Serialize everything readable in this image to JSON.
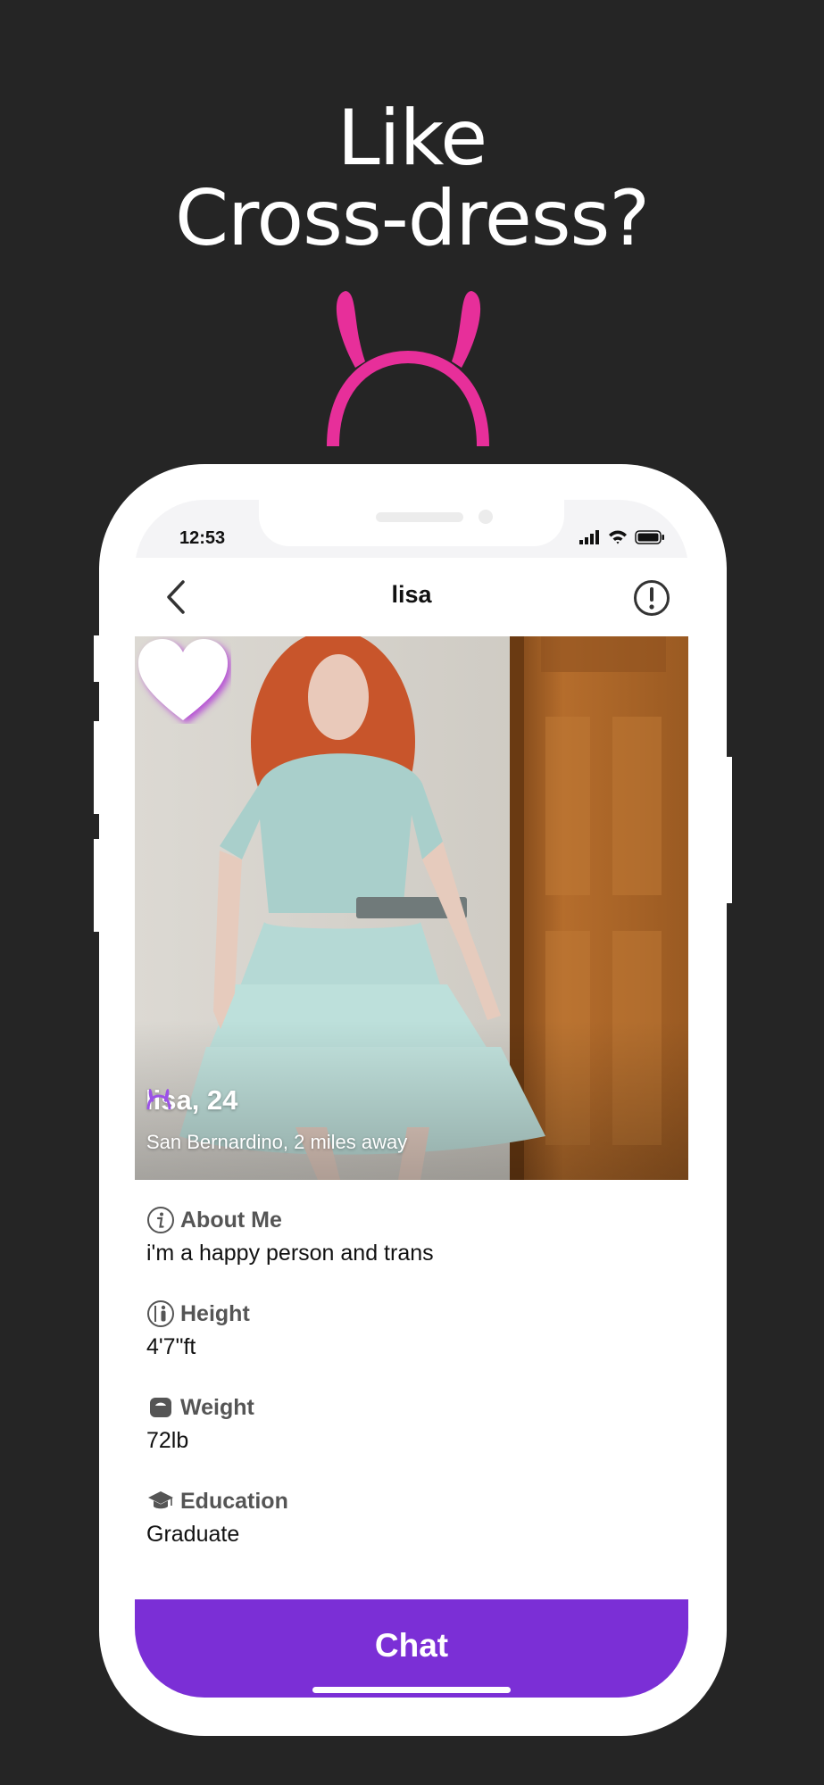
{
  "headline": {
    "line1": "Like",
    "line2": "Cross-dress?"
  },
  "colors": {
    "background": "#252525",
    "accent_pink": "#e72f9a",
    "chat_purple": "#7b2fd6",
    "icon_purple": "#9b52e6"
  },
  "status_bar": {
    "time": "12:53"
  },
  "nav": {
    "title": "lisa",
    "back_icon": "chevron-left-icon",
    "report_icon": "exclamation-circle-icon"
  },
  "profile": {
    "name_age": "lisa, 24",
    "location": "San Bernardino, 2 miles away",
    "badge_icon": "bunny-ears-icon",
    "like_icon": "heart-icon"
  },
  "info": [
    {
      "icon": "info-icon",
      "label": "About Me",
      "value": "i'm a happy person and  trans"
    },
    {
      "icon": "height-icon",
      "label": "Height",
      "value": "4'7\"ft"
    },
    {
      "icon": "scale-icon",
      "label": "Weight",
      "value": "72lb"
    },
    {
      "icon": "graduation-cap-icon",
      "label": "Education",
      "value": "Graduate"
    }
  ],
  "chat_button": {
    "label": "Chat"
  }
}
